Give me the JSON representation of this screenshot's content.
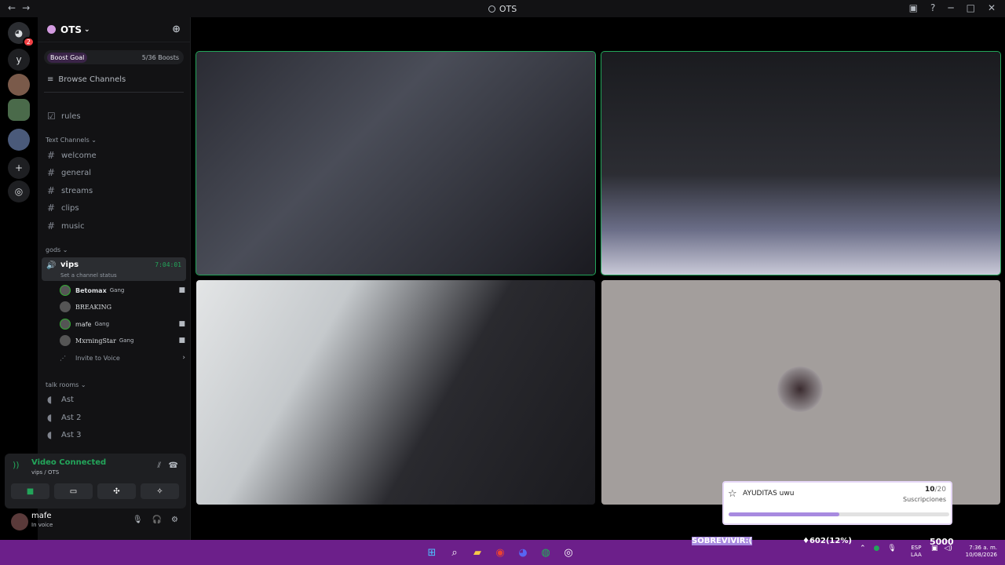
{
  "window": {
    "title": "OTS"
  },
  "servers": {
    "dm_badge": "2",
    "letter": "y"
  },
  "server": {
    "name": "OTS",
    "boost_goal": "Boost Goal",
    "boost_count": "5/36 Boosts",
    "browse": "Browse Channels",
    "rules": "rules",
    "text_category": "Text Channels",
    "text_channels": [
      "welcome",
      "general",
      "streams",
      "clips",
      "music"
    ],
    "gods_category": "gods",
    "voice_channel": {
      "name": "vips",
      "status": "Set a channel status",
      "timer": "7:04:01"
    },
    "voice_users": [
      {
        "name": "Betomax",
        "tag": "Gang"
      },
      {
        "name": "BREAKING",
        "tag": ""
      },
      {
        "name": "mafe",
        "tag": "Gang"
      },
      {
        "name": "MxrningStar",
        "tag": "Gang"
      }
    ],
    "invite": "Invite to Voice",
    "talk_category": "talk rooms",
    "talk_channels": [
      "Ast",
      "Ast 2",
      "Ast 3"
    ]
  },
  "voice_panel": {
    "title": "Video Connected",
    "subtitle": "vips / OTS"
  },
  "user_panel": {
    "name": "mafe",
    "status": "In voice"
  },
  "stream_widget": {
    "title": "AYUDITAS uwu",
    "count": "10",
    "total": "/20",
    "label": "Suscripciones",
    "progress": 0.5
  },
  "overlay": {
    "song": "SOBREVIVIR:(",
    "points": "602(12%)",
    "goal": "5000"
  },
  "tray": {
    "lang1": "ESP",
    "lang2": "LAA",
    "time": "7:36 a. m.",
    "date": "10/08/2026"
  },
  "colors": {
    "speaking": "#23a55a",
    "taskbar": "#6c1f8a",
    "accent": "#a88ae0"
  }
}
